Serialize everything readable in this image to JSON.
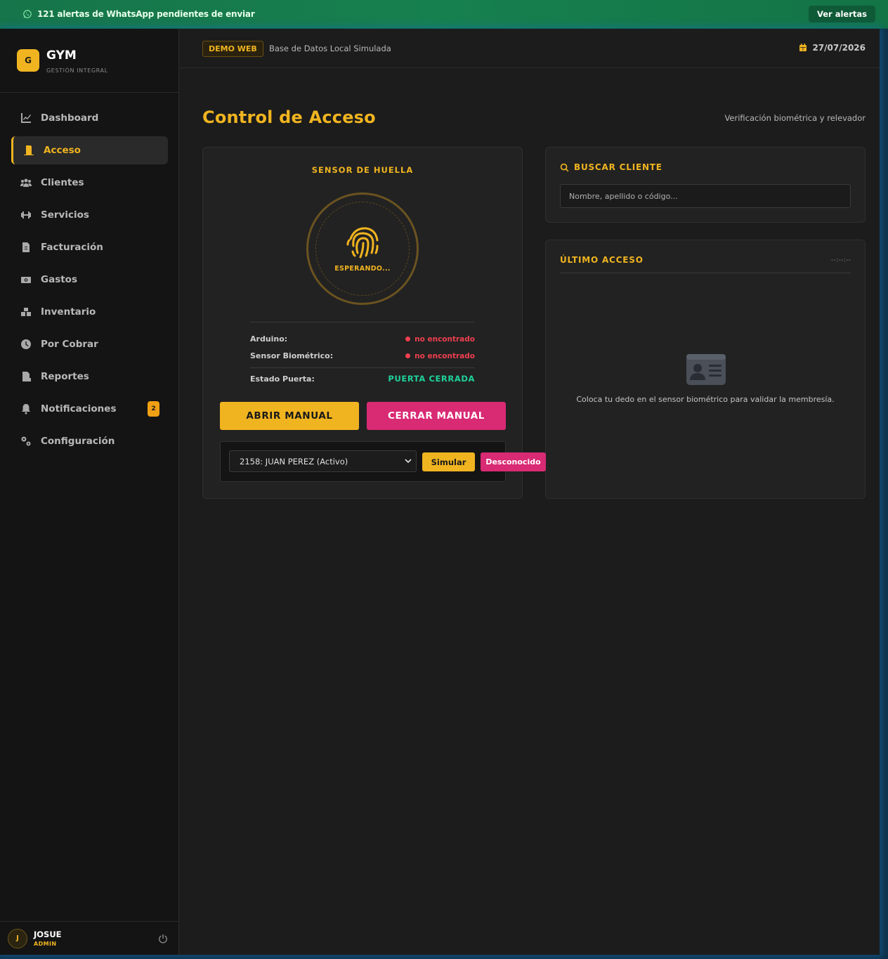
{
  "alert": {
    "text": "121 alertas de WhatsApp pendientes de enviar",
    "button": "Ver alertas"
  },
  "brand": {
    "logo_letter": "G",
    "name": "GYM",
    "subtitle": "GESTIÓN INTEGRAL"
  },
  "sidebar": {
    "items": [
      {
        "label": "Dashboard",
        "icon": "chart-line-icon"
      },
      {
        "label": "Acceso",
        "icon": "door-open-icon",
        "active": true
      },
      {
        "label": "Clientes",
        "icon": "users-icon"
      },
      {
        "label": "Servicios",
        "icon": "dumbbell-icon"
      },
      {
        "label": "Facturación",
        "icon": "invoice-icon"
      },
      {
        "label": "Gastos",
        "icon": "money-bill-icon"
      },
      {
        "label": "Inventario",
        "icon": "boxes-icon"
      },
      {
        "label": "Por Cobrar",
        "icon": "clock-icon"
      },
      {
        "label": "Reportes",
        "icon": "file-pdf-icon"
      },
      {
        "label": "Notificaciones",
        "icon": "bell-icon",
        "badge": "2"
      },
      {
        "label": "Configuración",
        "icon": "gears-icon"
      }
    ]
  },
  "user": {
    "initial": "J",
    "name": "JOSUE",
    "role": "ADMIN"
  },
  "topbar": {
    "badge": "DEMO WEB",
    "text": "Base de Datos Local Simulada",
    "date": "27/07/2026"
  },
  "page": {
    "title": "Control de Acceso",
    "subtitle": "Verificación biométrica y relevador"
  },
  "sensor": {
    "title": "SENSOR DE HUELLA",
    "status": "ESPERANDO...",
    "arduino_label": "Arduino:",
    "arduino_value": "no encontrado",
    "biometric_label": "Sensor Biométrico:",
    "biometric_value": "no encontrado",
    "door_label": "Estado Puerta:",
    "door_value": "PUERTA CERRADA",
    "open_button": "ABRIR MANUAL",
    "close_button": "CERRAR MANUAL",
    "select_value": "2158: JUAN PEREZ (Activo)",
    "simulate_button": "Simular",
    "unknown_button": "Desconocido"
  },
  "search": {
    "title": "BUSCAR CLIENTE",
    "placeholder": "Nombre, apellido o código..."
  },
  "last_access": {
    "title": "ÚLTIMO ACCESO",
    "time": "--:--:--",
    "message": "Coloca tu dedo en el sensor biométrico para validar la membresía."
  },
  "colors": {
    "accent": "#f0b420",
    "danger": "#d92a74",
    "success": "#1ed19a",
    "error": "#ef3f4f",
    "whatsapp": "#17804f"
  }
}
